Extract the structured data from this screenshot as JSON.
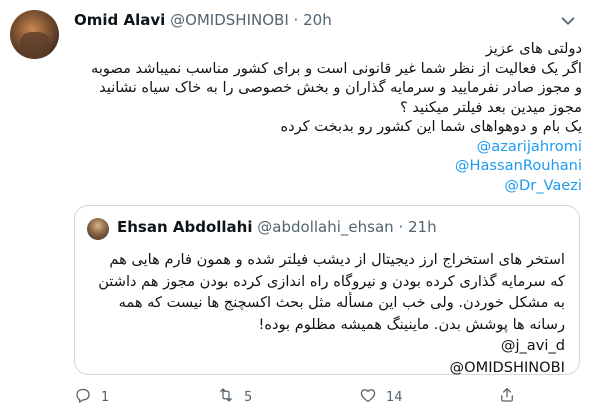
{
  "tweet": {
    "name": "Omid Alavi",
    "handle": "@OMIDSHINOBI",
    "separator": "·",
    "time": "20h",
    "lines": [
      "دولتی های عزیز",
      "اگر یک فعالیت از نظر شما غیر قانونی است و برای کشور مناسب نمیباشد مصوبه",
      "و مجوز صادر نفرمایید و سرمایه گذاران و بخش خصوصی را به خاک سیاه نشانید",
      "مجوز میدین بعد فیلتر میکنید ؟",
      "یک بام و دوهواهای شما این کشور رو بدبخت کرده"
    ],
    "mentions": [
      "@azarijahromi",
      "@HassanRouhani",
      "@Dr_Vaezi"
    ]
  },
  "quote": {
    "name": "Ehsan Abdollahi",
    "handle": "@abdollahi_ehsan",
    "separator": "·",
    "time": "21h",
    "lines": [
      "استخر های استخراج ارز دیجیتال از دیشب فیلتر شده و همون فارم هایی هم",
      "که سرمایه گذاری کرده بودن و نیروگاه راه اندازی کرده بودن مجوز هم داشتن",
      "به مشکل خوردن. ولی خب این مسأله مثل بحث اکسچنج ها نیست که همه",
      "رسانه ها پوشش بدن. ماینینگ همیشه مظلوم بوده!"
    ],
    "mentions": [
      "@j_avi_d",
      "@OMIDSHINOBI"
    ]
  },
  "actions": {
    "reply_count": "1",
    "retweet_count": "5",
    "like_count": "14"
  }
}
